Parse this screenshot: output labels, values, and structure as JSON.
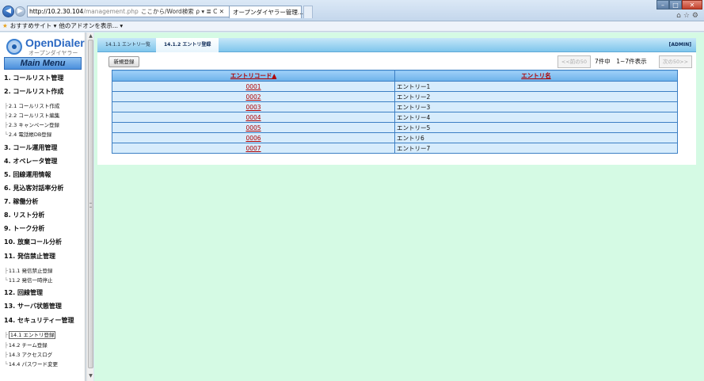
{
  "browser": {
    "url_host": "http://10.2.30.104",
    "url_path": "/management.php",
    "address_tools": "ここから/Word検索 ρ ▾ ≣ C ✕",
    "tab_title": "オープンダイヤラー管理...",
    "fav_sites_label": "おすすめサイト ▾",
    "fav_addons_label": "他のアドオンを表示... ▾"
  },
  "sidebar": {
    "logo_name": "OpenDialer",
    "logo_sub": "オープンダイヤラー",
    "main_menu": "Main Menu",
    "items": [
      {
        "label": "1. コールリスト管理"
      },
      {
        "label": "2. コールリスト作成"
      },
      {
        "label": "3. コール運用管理"
      },
      {
        "label": "4. オペレータ管理"
      },
      {
        "label": "5. 回線運用情報"
      },
      {
        "label": "6. 見込客対話率分析"
      },
      {
        "label": "7. 稼働分析"
      },
      {
        "label": "8. リスト分析"
      },
      {
        "label": "9. トーク分析"
      },
      {
        "label": "10. 放棄コール分析"
      },
      {
        "label": "11. 発信禁止管理"
      },
      {
        "label": "12. 回線管理"
      },
      {
        "label": "13. サーバ状態管理"
      },
      {
        "label": "14. セキュリティー管理"
      }
    ],
    "sub2": [
      {
        "branch": "├",
        "label": "2.1 コールリスト作成"
      },
      {
        "branch": "├",
        "label": "2.2 コールリスト編集"
      },
      {
        "branch": "├",
        "label": "2.3 キャンペーン登録"
      },
      {
        "branch": "└",
        "label": "2.4 電話帳DB登録"
      }
    ],
    "sub11": [
      {
        "branch": "├",
        "label": "11.1 発信禁止登録"
      },
      {
        "branch": "└",
        "label": "11.2 発信一時停止"
      }
    ],
    "sub14": [
      {
        "branch": "├",
        "label": "14.1 エントリ登録"
      },
      {
        "branch": "├",
        "label": "14.2 チーム登録"
      },
      {
        "branch": "├",
        "label": "14.3 アクセスログ"
      },
      {
        "branch": "└",
        "label": "14.4 パスワード変更"
      }
    ]
  },
  "content": {
    "tabs": [
      {
        "label": "14.1.1 エントリ一覧"
      },
      {
        "label": "14.1.2 エントリ登録"
      }
    ],
    "user_badge": "[ADMIN]",
    "new_button": "新規登録",
    "pager_prev": "<<前の50",
    "pager_info": "7件中　1~7件表示",
    "pager_next": "次の50>>",
    "table": {
      "headers": [
        "エントリコード▲",
        "エントリ名"
      ],
      "rows": [
        [
          "0001",
          "エントリー1"
        ],
        [
          "0002",
          "エントリー2"
        ],
        [
          "0003",
          "エントリー3"
        ],
        [
          "0004",
          "エントリー4"
        ],
        [
          "0005",
          "エントリー5"
        ],
        [
          "0006",
          "エントリ6"
        ],
        [
          "0007",
          "エントリー7"
        ]
      ]
    }
  }
}
